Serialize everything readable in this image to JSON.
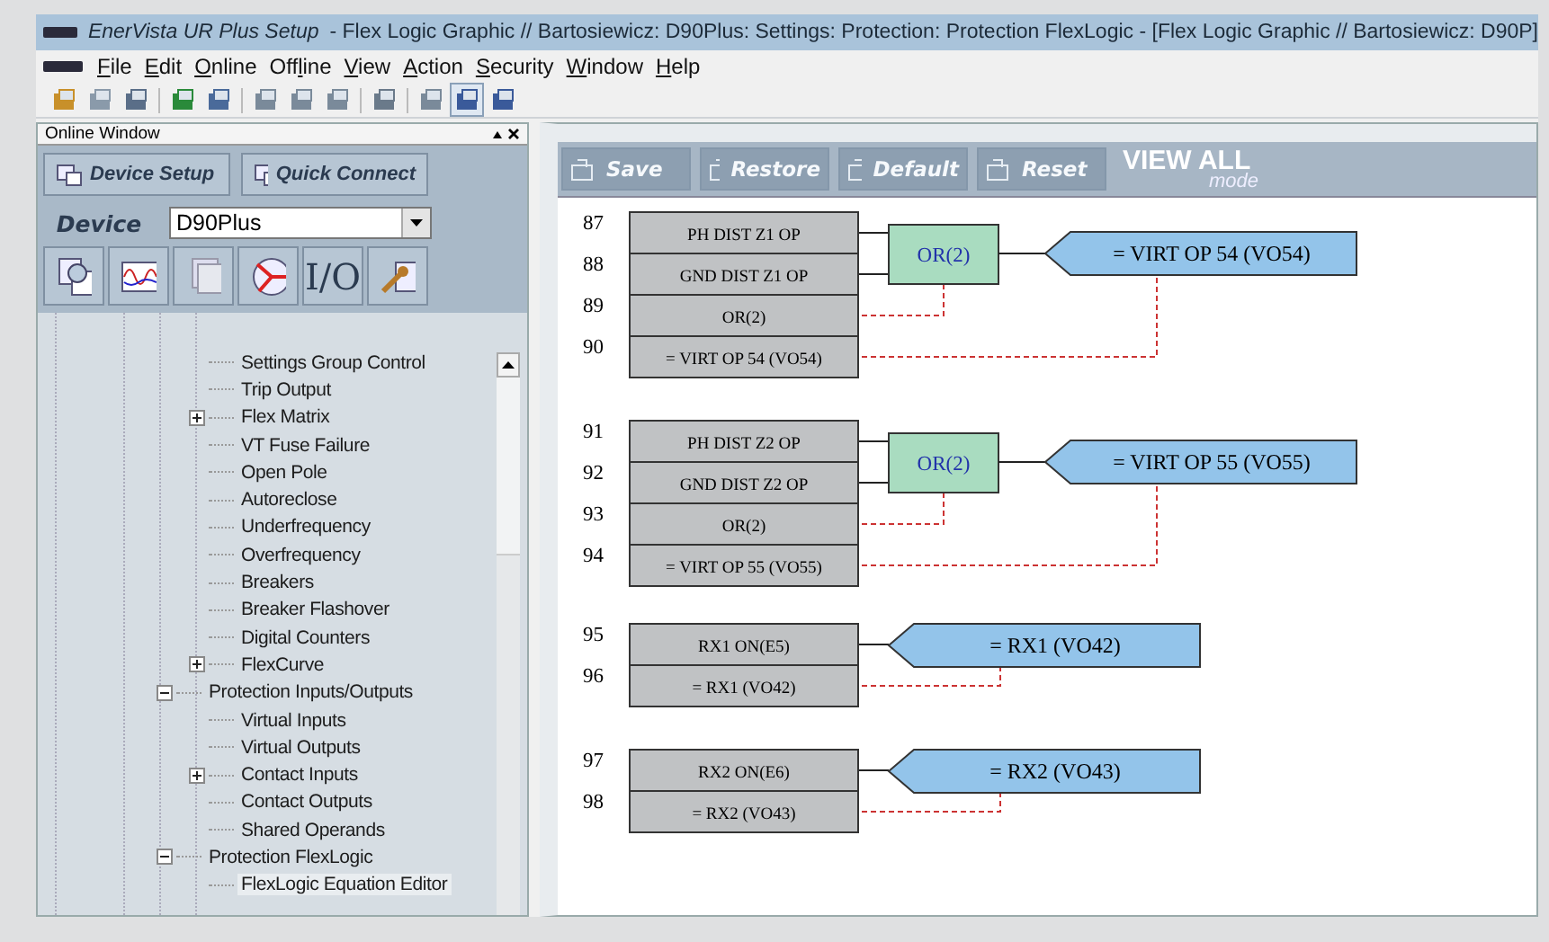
{
  "window": {
    "app_name": "EnerVista UR Plus Setup",
    "title": "- Flex Logic Graphic // Bartosiewicz: D90Plus: Settings: Protection: Protection FlexLogic - [Flex Logic Graphic // Bartosiewicz: D90P]"
  },
  "menu": [
    "File",
    "Edit",
    "Online",
    "Offline",
    "View",
    "Action",
    "Security",
    "Window",
    "Help"
  ],
  "toolbar": [
    {
      "selected": false
    },
    {
      "selected": false
    },
    {
      "selected": false
    },
    {
      "selected": false
    },
    {
      "selected": false
    },
    {
      "selected": false
    },
    {
      "selected": false
    },
    {
      "selected": false
    },
    {
      "selected": false
    },
    {
      "selected": false
    },
    {
      "selected": true
    },
    {
      "selected": false
    }
  ],
  "online_window": {
    "title": "Online Window",
    "buttons": [
      "Device Setup",
      "Quick Connect"
    ],
    "device_label": "Device",
    "device_value": "D90Plus",
    "io_label": "I/O",
    "tree": [
      {
        "children": [
          {
            "label": "Settings Group Control",
            "selected": false
          },
          {
            "label": "Trip Output",
            "selected": false
          },
          {
            "label": "Flex Matrix",
            "selected": false,
            "expanded": false
          },
          {
            "label": "VT Fuse Failure",
            "selected": false
          },
          {
            "label": "Open Pole",
            "selected": false
          },
          {
            "label": "Autoreclose",
            "selected": false
          },
          {
            "label": "Underfrequency",
            "selected": false
          },
          {
            "label": "Overfrequency",
            "selected": false
          },
          {
            "label": "Breakers",
            "selected": false
          },
          {
            "label": "Breaker Flashover",
            "selected": false
          },
          {
            "label": "Digital Counters",
            "selected": false
          },
          {
            "label": "FlexCurve",
            "selected": false,
            "expanded": false
          }
        ]
      },
      {
        "label": "Protection Inputs/Outputs",
        "selected": false,
        "expanded": true,
        "children": [
          {
            "label": "Virtual Inputs",
            "selected": false
          },
          {
            "label": "Virtual Outputs",
            "selected": false
          },
          {
            "label": "Contact Inputs",
            "selected": false,
            "expanded": false
          },
          {
            "label": "Contact Outputs",
            "selected": false
          },
          {
            "label": "Shared Operands",
            "selected": false
          }
        ]
      },
      {
        "label": "Protection FlexLogic",
        "selected": false,
        "expanded": true,
        "children": [
          {
            "label": "FlexLogic Equation Editor",
            "selected": true
          }
        ]
      }
    ]
  },
  "editor_toolbar": {
    "buttons": [
      {
        "label": "Save",
        "disabled": true
      },
      {
        "label": "Restore",
        "disabled": true
      },
      {
        "label": "Default",
        "disabled": true
      },
      {
        "label": "Reset",
        "disabled": true
      }
    ],
    "view_mode": "VIEW ALL",
    "view_mode_sub": "mode"
  },
  "diagram": {
    "groups": [
      {
        "gate": "OR(2)",
        "output": "= VIRT OP 54 (VO54)",
        "rows": [
          {
            "number": "87",
            "operand": "PH DIST Z1 OP",
            "kind": "input"
          },
          {
            "number": "88",
            "operand": "GND DIST Z1 OP",
            "kind": "input"
          },
          {
            "number": "89",
            "operand": "OR(2)",
            "kind": "gate"
          },
          {
            "number": "90",
            "operand": "= VIRT OP 54 (VO54)",
            "kind": "output"
          }
        ]
      },
      {
        "gate": "OR(2)",
        "output": "= VIRT OP 55 (VO55)",
        "rows": [
          {
            "number": "91",
            "operand": "PH DIST Z2 OP",
            "kind": "input"
          },
          {
            "number": "92",
            "operand": "GND DIST Z2 OP",
            "kind": "input"
          },
          {
            "number": "93",
            "operand": "OR(2)",
            "kind": "gate"
          },
          {
            "number": "94",
            "operand": "= VIRT OP 55 (VO55)",
            "kind": "output"
          }
        ]
      },
      {
        "output": "= RX1 (VO42)",
        "rows": [
          {
            "number": "95",
            "operand": "RX1 ON(E5)",
            "kind": "input"
          },
          {
            "number": "96",
            "operand": "= RX1 (VO42)",
            "kind": "output"
          }
        ]
      },
      {
        "output": "= RX2 (VO43)",
        "rows": [
          {
            "number": "97",
            "operand": "RX2 ON(E6)",
            "kind": "input"
          },
          {
            "number": "98",
            "operand": "= RX2 (VO43)",
            "kind": "output"
          }
        ]
      }
    ]
  }
}
